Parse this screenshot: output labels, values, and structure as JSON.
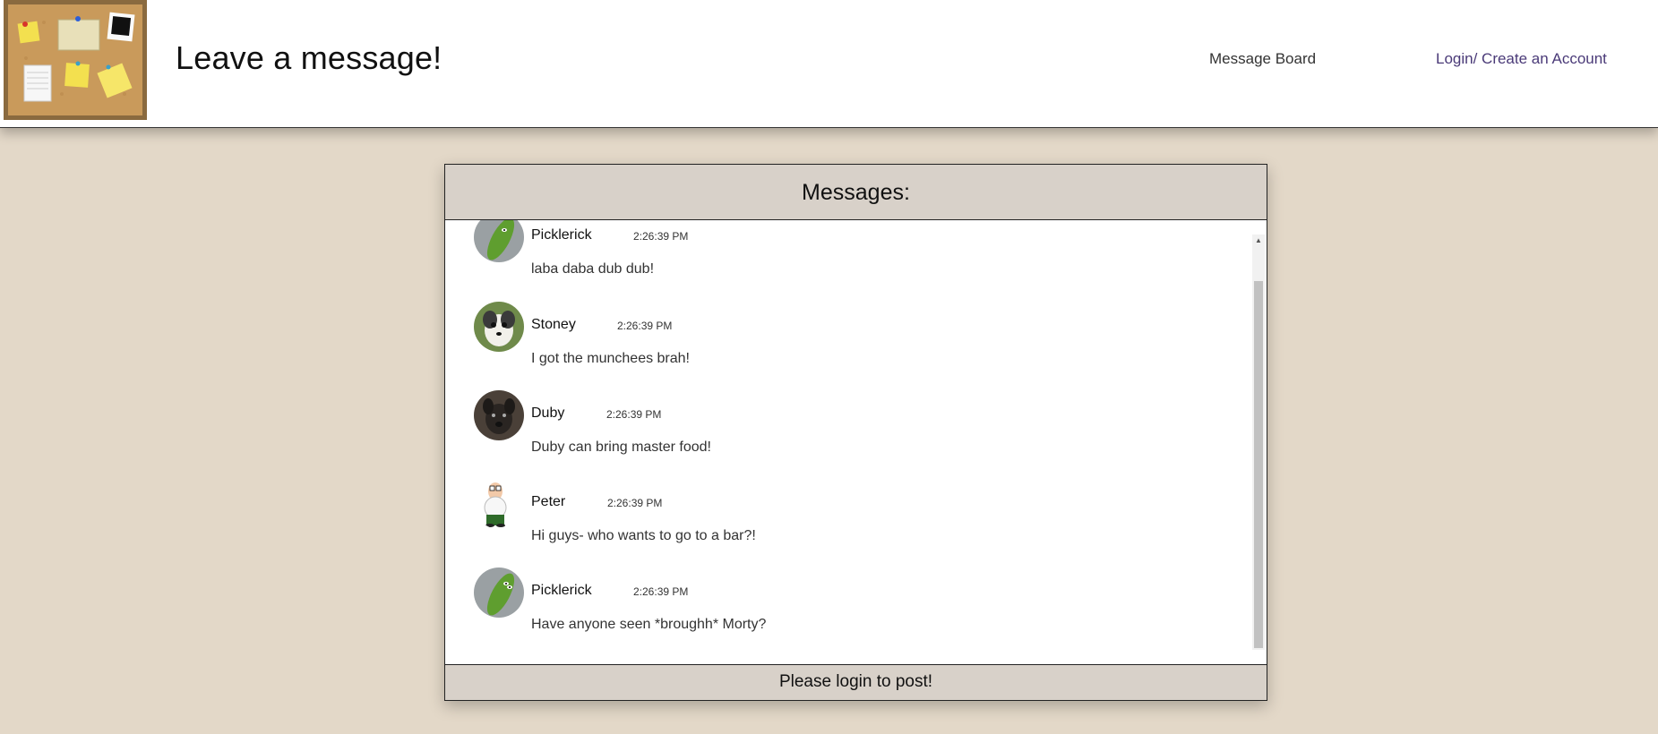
{
  "header": {
    "title": "Leave a message!",
    "nav": {
      "board_label": "Message Board",
      "login_label": "Login/ Create an Account"
    },
    "logo_icon": "corkboard-logo-icon"
  },
  "board": {
    "heading": "Messages:",
    "footer_text": "Please login to post!",
    "messages": [
      {
        "name": "Picklerick",
        "time": "2:26:39 PM",
        "text": "laba daba dub dub!",
        "avatar": "pickle-avatar"
      },
      {
        "name": "Stoney",
        "time": "2:26:39 PM",
        "text": "I got the munchees brah!",
        "avatar": "chihuahua-avatar"
      },
      {
        "name": "Duby",
        "time": "2:26:39 PM",
        "text": "Duby can bring master food!",
        "avatar": "dog-avatar"
      },
      {
        "name": "Peter",
        "time": "2:26:39 PM",
        "text": "Hi guys- who wants to go to a bar?!",
        "avatar": "cartoon-man-avatar"
      },
      {
        "name": "Picklerick",
        "time": "2:26:39 PM",
        "text": "Have anyone seen *broughh* Morty?",
        "avatar": "pickle-avatar"
      }
    ]
  },
  "colors": {
    "page_bg": "#e3d8c8",
    "panel_header_bg": "#d8d1c9",
    "login_link": "#4a3a78"
  }
}
